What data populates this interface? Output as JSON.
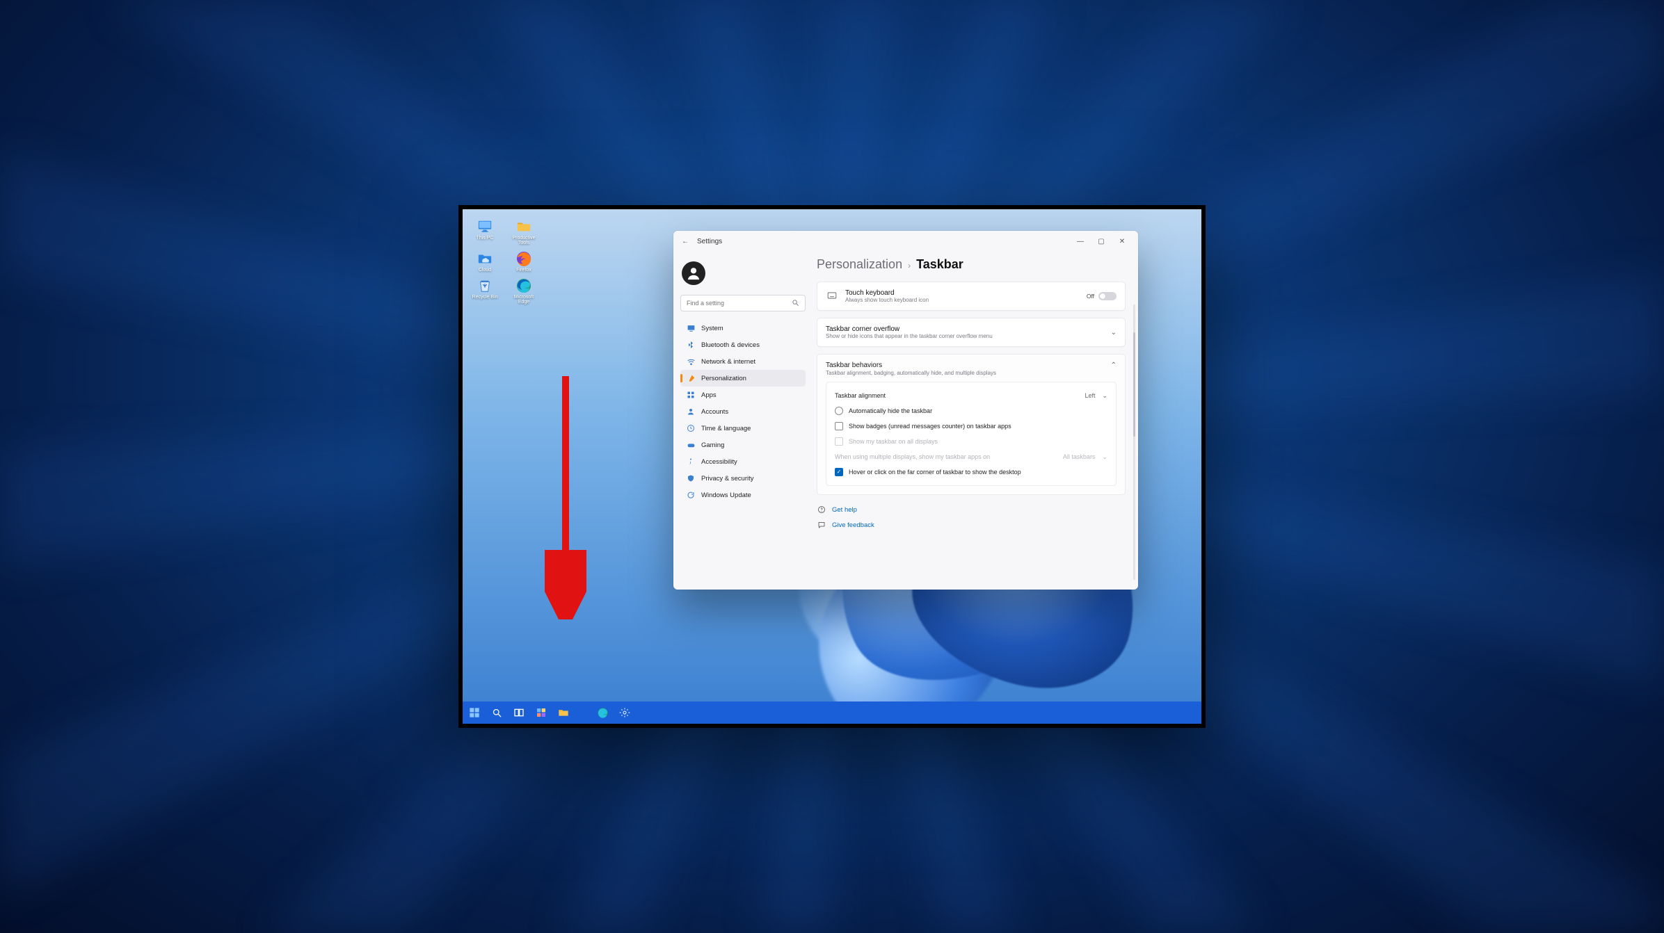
{
  "desktop": {
    "icons": [
      [
        {
          "label": "This PC"
        },
        {
          "label": "Productive Tools"
        }
      ],
      [
        {
          "label": "Cloud"
        },
        {
          "label": "Firefox"
        }
      ],
      [
        {
          "label": "Recycle Bin"
        },
        {
          "label": "Microsoft Edge"
        }
      ]
    ]
  },
  "settings_window": {
    "title": "Settings",
    "window_controls": {
      "min": "—",
      "max": "▢",
      "close": "✕"
    },
    "sidebar": {
      "search_placeholder": "Find a setting",
      "items": [
        {
          "icon": "system",
          "label": "System"
        },
        {
          "icon": "bluetooth",
          "label": "Bluetooth & devices"
        },
        {
          "icon": "network",
          "label": "Network & internet"
        },
        {
          "icon": "personalize",
          "label": "Personalization",
          "selected": true
        },
        {
          "icon": "apps",
          "label": "Apps"
        },
        {
          "icon": "accounts",
          "label": "Accounts"
        },
        {
          "icon": "time",
          "label": "Time & language"
        },
        {
          "icon": "gaming",
          "label": "Gaming"
        },
        {
          "icon": "accessibility",
          "label": "Accessibility"
        },
        {
          "icon": "privacy",
          "label": "Privacy & security"
        },
        {
          "icon": "update",
          "label": "Windows Update"
        }
      ]
    },
    "content": {
      "breadcrumb": {
        "parent": "Personalization",
        "current": "Taskbar"
      },
      "touch_keyboard": {
        "title": "Touch keyboard",
        "subtitle": "Always show touch keyboard icon",
        "toggle_label": "Off"
      },
      "overflow": {
        "title": "Taskbar corner overflow",
        "subtitle": "Show or hide icons that appear in the taskbar corner overflow menu"
      },
      "behaviors": {
        "title": "Taskbar behaviors",
        "subtitle": "Taskbar alignment, badging, automatically hide, and multiple displays",
        "alignment_label": "Taskbar alignment",
        "alignment_value": "Left",
        "auto_hide": "Automatically hide the taskbar",
        "badges": "Show badges (unread messages counter) on taskbar apps",
        "show_all_displays": "Show my taskbar on all displays",
        "multi_label": "When using multiple displays, show my taskbar apps on",
        "multi_value": "All taskbars",
        "hover_corner": "Hover or click on the far corner of taskbar to show the desktop"
      },
      "links": {
        "get_help": "Get help",
        "give_feedback": "Give feedback"
      }
    }
  },
  "taskbar": {
    "icons": [
      "start",
      "search",
      "taskview",
      "widgets",
      "explorer",
      "edge",
      "settings"
    ]
  }
}
